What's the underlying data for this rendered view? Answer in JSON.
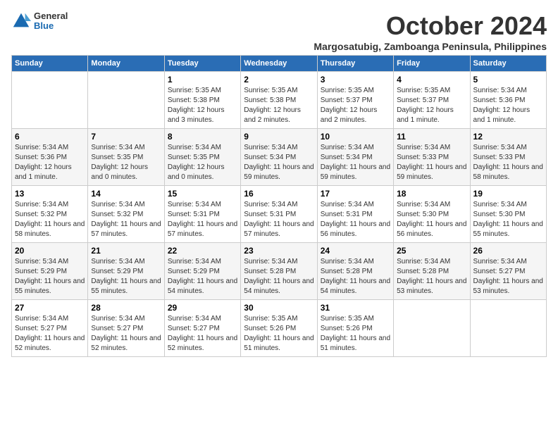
{
  "logo": {
    "general": "General",
    "blue": "Blue"
  },
  "title": "October 2024",
  "location": "Margosatubig, Zamboanga Peninsula, Philippines",
  "weekdays": [
    "Sunday",
    "Monday",
    "Tuesday",
    "Wednesday",
    "Thursday",
    "Friday",
    "Saturday"
  ],
  "weeks": [
    [
      {
        "day": "",
        "info": ""
      },
      {
        "day": "",
        "info": ""
      },
      {
        "day": "1",
        "info": "Sunrise: 5:35 AM\nSunset: 5:38 PM\nDaylight: 12 hours and 3 minutes."
      },
      {
        "day": "2",
        "info": "Sunrise: 5:35 AM\nSunset: 5:38 PM\nDaylight: 12 hours and 2 minutes."
      },
      {
        "day": "3",
        "info": "Sunrise: 5:35 AM\nSunset: 5:37 PM\nDaylight: 12 hours and 2 minutes."
      },
      {
        "day": "4",
        "info": "Sunrise: 5:35 AM\nSunset: 5:37 PM\nDaylight: 12 hours and 1 minute."
      },
      {
        "day": "5",
        "info": "Sunrise: 5:34 AM\nSunset: 5:36 PM\nDaylight: 12 hours and 1 minute."
      }
    ],
    [
      {
        "day": "6",
        "info": "Sunrise: 5:34 AM\nSunset: 5:36 PM\nDaylight: 12 hours and 1 minute."
      },
      {
        "day": "7",
        "info": "Sunrise: 5:34 AM\nSunset: 5:35 PM\nDaylight: 12 hours and 0 minutes."
      },
      {
        "day": "8",
        "info": "Sunrise: 5:34 AM\nSunset: 5:35 PM\nDaylight: 12 hours and 0 minutes."
      },
      {
        "day": "9",
        "info": "Sunrise: 5:34 AM\nSunset: 5:34 PM\nDaylight: 11 hours and 59 minutes."
      },
      {
        "day": "10",
        "info": "Sunrise: 5:34 AM\nSunset: 5:34 PM\nDaylight: 11 hours and 59 minutes."
      },
      {
        "day": "11",
        "info": "Sunrise: 5:34 AM\nSunset: 5:33 PM\nDaylight: 11 hours and 59 minutes."
      },
      {
        "day": "12",
        "info": "Sunrise: 5:34 AM\nSunset: 5:33 PM\nDaylight: 11 hours and 58 minutes."
      }
    ],
    [
      {
        "day": "13",
        "info": "Sunrise: 5:34 AM\nSunset: 5:32 PM\nDaylight: 11 hours and 58 minutes."
      },
      {
        "day": "14",
        "info": "Sunrise: 5:34 AM\nSunset: 5:32 PM\nDaylight: 11 hours and 57 minutes."
      },
      {
        "day": "15",
        "info": "Sunrise: 5:34 AM\nSunset: 5:31 PM\nDaylight: 11 hours and 57 minutes."
      },
      {
        "day": "16",
        "info": "Sunrise: 5:34 AM\nSunset: 5:31 PM\nDaylight: 11 hours and 57 minutes."
      },
      {
        "day": "17",
        "info": "Sunrise: 5:34 AM\nSunset: 5:31 PM\nDaylight: 11 hours and 56 minutes."
      },
      {
        "day": "18",
        "info": "Sunrise: 5:34 AM\nSunset: 5:30 PM\nDaylight: 11 hours and 56 minutes."
      },
      {
        "day": "19",
        "info": "Sunrise: 5:34 AM\nSunset: 5:30 PM\nDaylight: 11 hours and 55 minutes."
      }
    ],
    [
      {
        "day": "20",
        "info": "Sunrise: 5:34 AM\nSunset: 5:29 PM\nDaylight: 11 hours and 55 minutes."
      },
      {
        "day": "21",
        "info": "Sunrise: 5:34 AM\nSunset: 5:29 PM\nDaylight: 11 hours and 55 minutes."
      },
      {
        "day": "22",
        "info": "Sunrise: 5:34 AM\nSunset: 5:29 PM\nDaylight: 11 hours and 54 minutes."
      },
      {
        "day": "23",
        "info": "Sunrise: 5:34 AM\nSunset: 5:28 PM\nDaylight: 11 hours and 54 minutes."
      },
      {
        "day": "24",
        "info": "Sunrise: 5:34 AM\nSunset: 5:28 PM\nDaylight: 11 hours and 54 minutes."
      },
      {
        "day": "25",
        "info": "Sunrise: 5:34 AM\nSunset: 5:28 PM\nDaylight: 11 hours and 53 minutes."
      },
      {
        "day": "26",
        "info": "Sunrise: 5:34 AM\nSunset: 5:27 PM\nDaylight: 11 hours and 53 minutes."
      }
    ],
    [
      {
        "day": "27",
        "info": "Sunrise: 5:34 AM\nSunset: 5:27 PM\nDaylight: 11 hours and 52 minutes."
      },
      {
        "day": "28",
        "info": "Sunrise: 5:34 AM\nSunset: 5:27 PM\nDaylight: 11 hours and 52 minutes."
      },
      {
        "day": "29",
        "info": "Sunrise: 5:34 AM\nSunset: 5:27 PM\nDaylight: 11 hours and 52 minutes."
      },
      {
        "day": "30",
        "info": "Sunrise: 5:35 AM\nSunset: 5:26 PM\nDaylight: 11 hours and 51 minutes."
      },
      {
        "day": "31",
        "info": "Sunrise: 5:35 AM\nSunset: 5:26 PM\nDaylight: 11 hours and 51 minutes."
      },
      {
        "day": "",
        "info": ""
      },
      {
        "day": "",
        "info": ""
      }
    ]
  ]
}
